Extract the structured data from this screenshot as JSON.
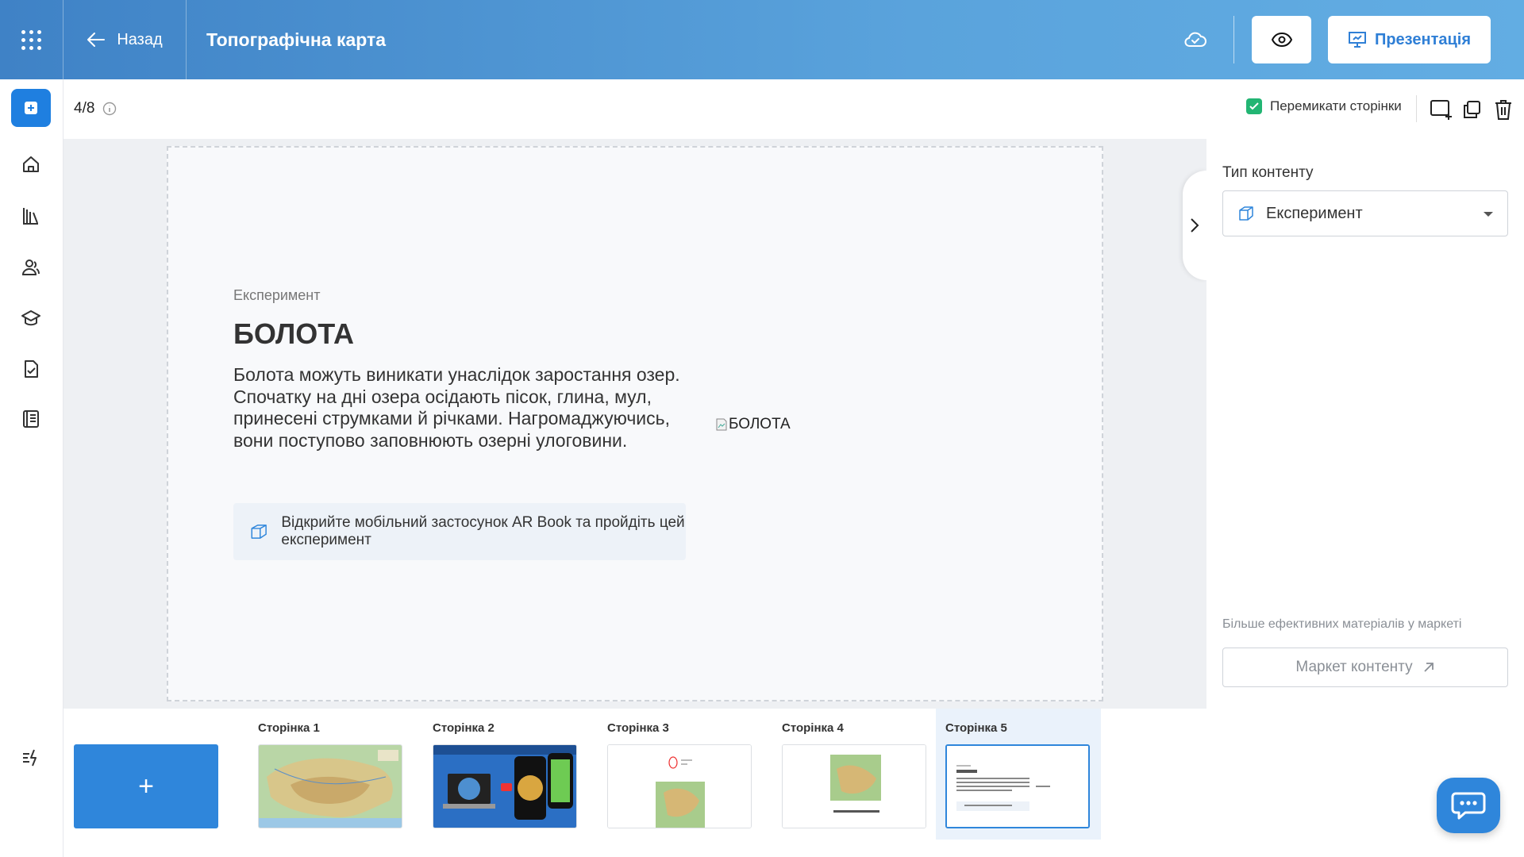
{
  "header": {
    "back_label": "Назад",
    "doc_title": "Топографічна карта",
    "presentation_label": "Презентація"
  },
  "toolbar": {
    "page_counter": "4/8",
    "switch_pages_label": "Перемикати сторінки",
    "switch_pages_checked": true
  },
  "slide": {
    "kicker": "Експеримент",
    "title": "БОЛОТА",
    "text": "Болота можуть виникати унаслідок заростання озер. Спочатку на дні озера осідають пісок, глина, мул, принесені струмками й річками. Нагромаджуючись, вони поступово заповнюють озерні улоговини.",
    "ar_note": "Відкрийте мобільний застосунок AR Book та пройдіть цей експеримент",
    "image_alt": "БОЛОТА"
  },
  "right_panel": {
    "content_type_label": "Тип контенту",
    "content_type_value": "Експеримент",
    "market_note": "Більше ефективних матеріалів у маркеті",
    "market_button": "Маркет контенту"
  },
  "thumbnails": [
    {
      "label": "Сторінка 1"
    },
    {
      "label": "Сторінка 2"
    },
    {
      "label": "Сторінка 3"
    },
    {
      "label": "Сторінка 4"
    },
    {
      "label": "Сторінка 5",
      "active": true
    }
  ],
  "add_page_label": "+",
  "colors": {
    "accent": "#2f86db",
    "header_start": "#3f82c6",
    "header_end": "#62ade3",
    "checkbox": "#22b573"
  },
  "icons": [
    "apps-grid-icon",
    "arrow-left-icon",
    "cloud-check-icon",
    "eye-icon",
    "presentation-icon",
    "add-square-icon",
    "home-icon",
    "library-icon",
    "users-icon",
    "courses-icon",
    "tasks-icon",
    "journal-icon",
    "quick-actions-icon",
    "info-icon",
    "add-page-icon",
    "duplicate-icon",
    "trash-icon",
    "cube-icon",
    "chevron-right-icon",
    "external-link-icon",
    "chat-icon"
  ]
}
